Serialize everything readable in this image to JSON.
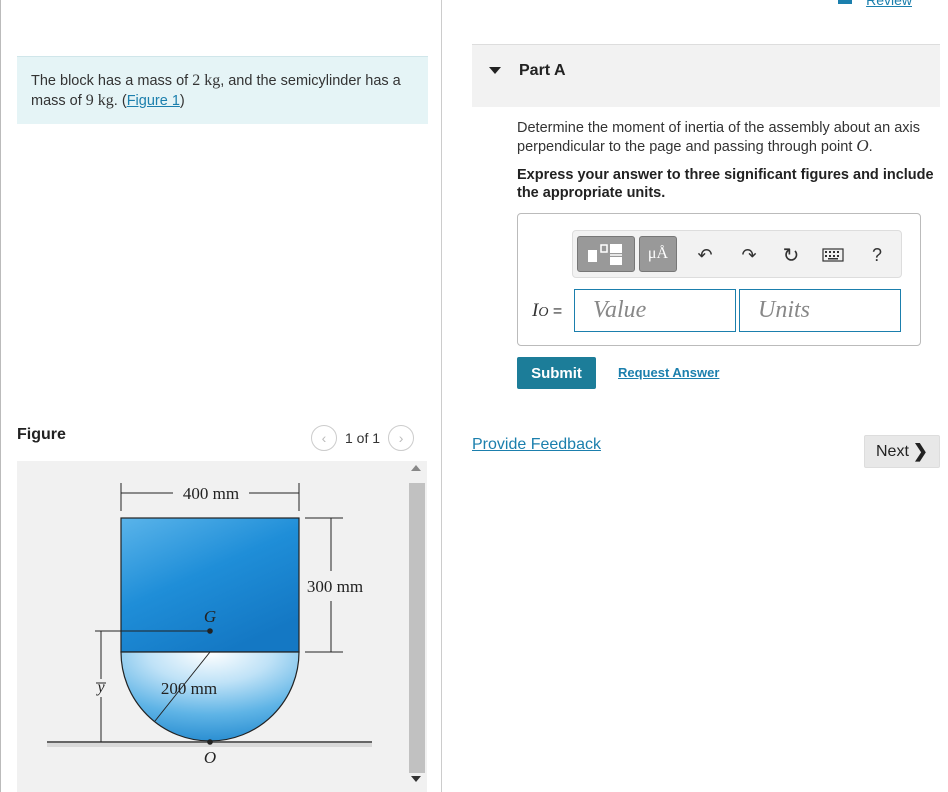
{
  "problem": {
    "text_before_mass1": "The block has a mass of ",
    "mass1": "2 kg",
    "text_between": ", and the semicylinder has a mass of ",
    "mass2": "9 kg",
    "text_after": ". (",
    "figure_link": "Figure 1",
    "close_paren": ")"
  },
  "figure_panel": {
    "label": "Figure",
    "page_indicator": "1 of 1",
    "dim_width": "400 mm",
    "dim_height": "300 mm",
    "dim_radius": "200 mm",
    "point_g": "G",
    "point_o": "O",
    "ybar": "y"
  },
  "header": {
    "review_link": "Review"
  },
  "part": {
    "title": "Part A"
  },
  "question": {
    "text": "Determine the moment of inertia of the assembly about an axis perpendicular to the page and passing through point ",
    "point": "O",
    "period": ".",
    "instruction": "Express your answer to three significant figures and include the appropriate units."
  },
  "answer": {
    "label_var": "I",
    "label_sub": "O",
    "label_eq": " =",
    "value_placeholder": "Value",
    "units_placeholder": "Units",
    "toolbar_units_glyph": "μÅ",
    "toolbar_help_glyph": "?"
  },
  "actions": {
    "submit": "Submit",
    "request_answer": "Request Answer",
    "provide_feedback": "Provide Feedback",
    "next": "Next"
  },
  "colors": {
    "accent": "#1b7fad",
    "submit_bg": "#1c7d99",
    "problem_bg": "#e5f4f6",
    "block_blue": "#1e8fd8"
  }
}
